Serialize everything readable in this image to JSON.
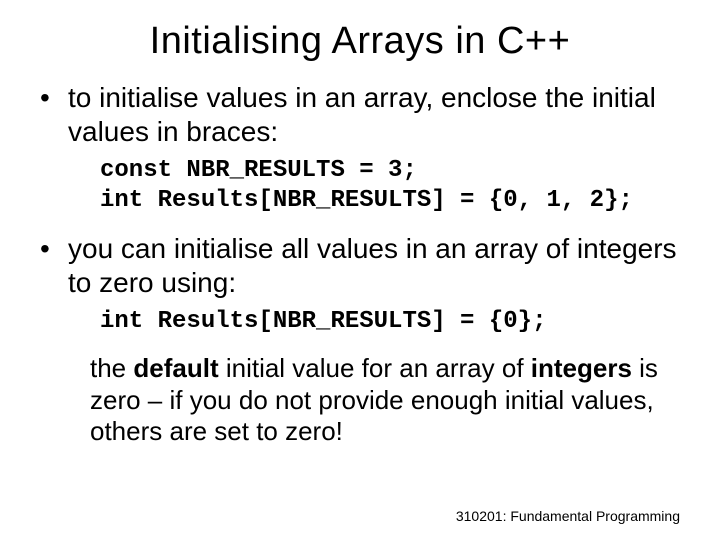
{
  "title": "Initialising Arrays in C++",
  "bullet1": "to initialise values in an array, enclose the initial values in braces:",
  "code1_line1": "const NBR_RESULTS = 3;",
  "code1_line2": "int Results[NBR_RESULTS] = {0, 1, 2};",
  "bullet2": "you can initialise all values in an array of integers to zero using:",
  "code2_line1": "int Results[NBR_RESULTS] = {0};",
  "note_pre": "the ",
  "note_bold": "default",
  "note_mid": "  initial value for an array of ",
  "note_bold2": "integers",
  "note_post": " is zero – if you do not provide enough initial values, others are set to zero!",
  "footer": "310201: Fundamental Programming",
  "dot": "•"
}
